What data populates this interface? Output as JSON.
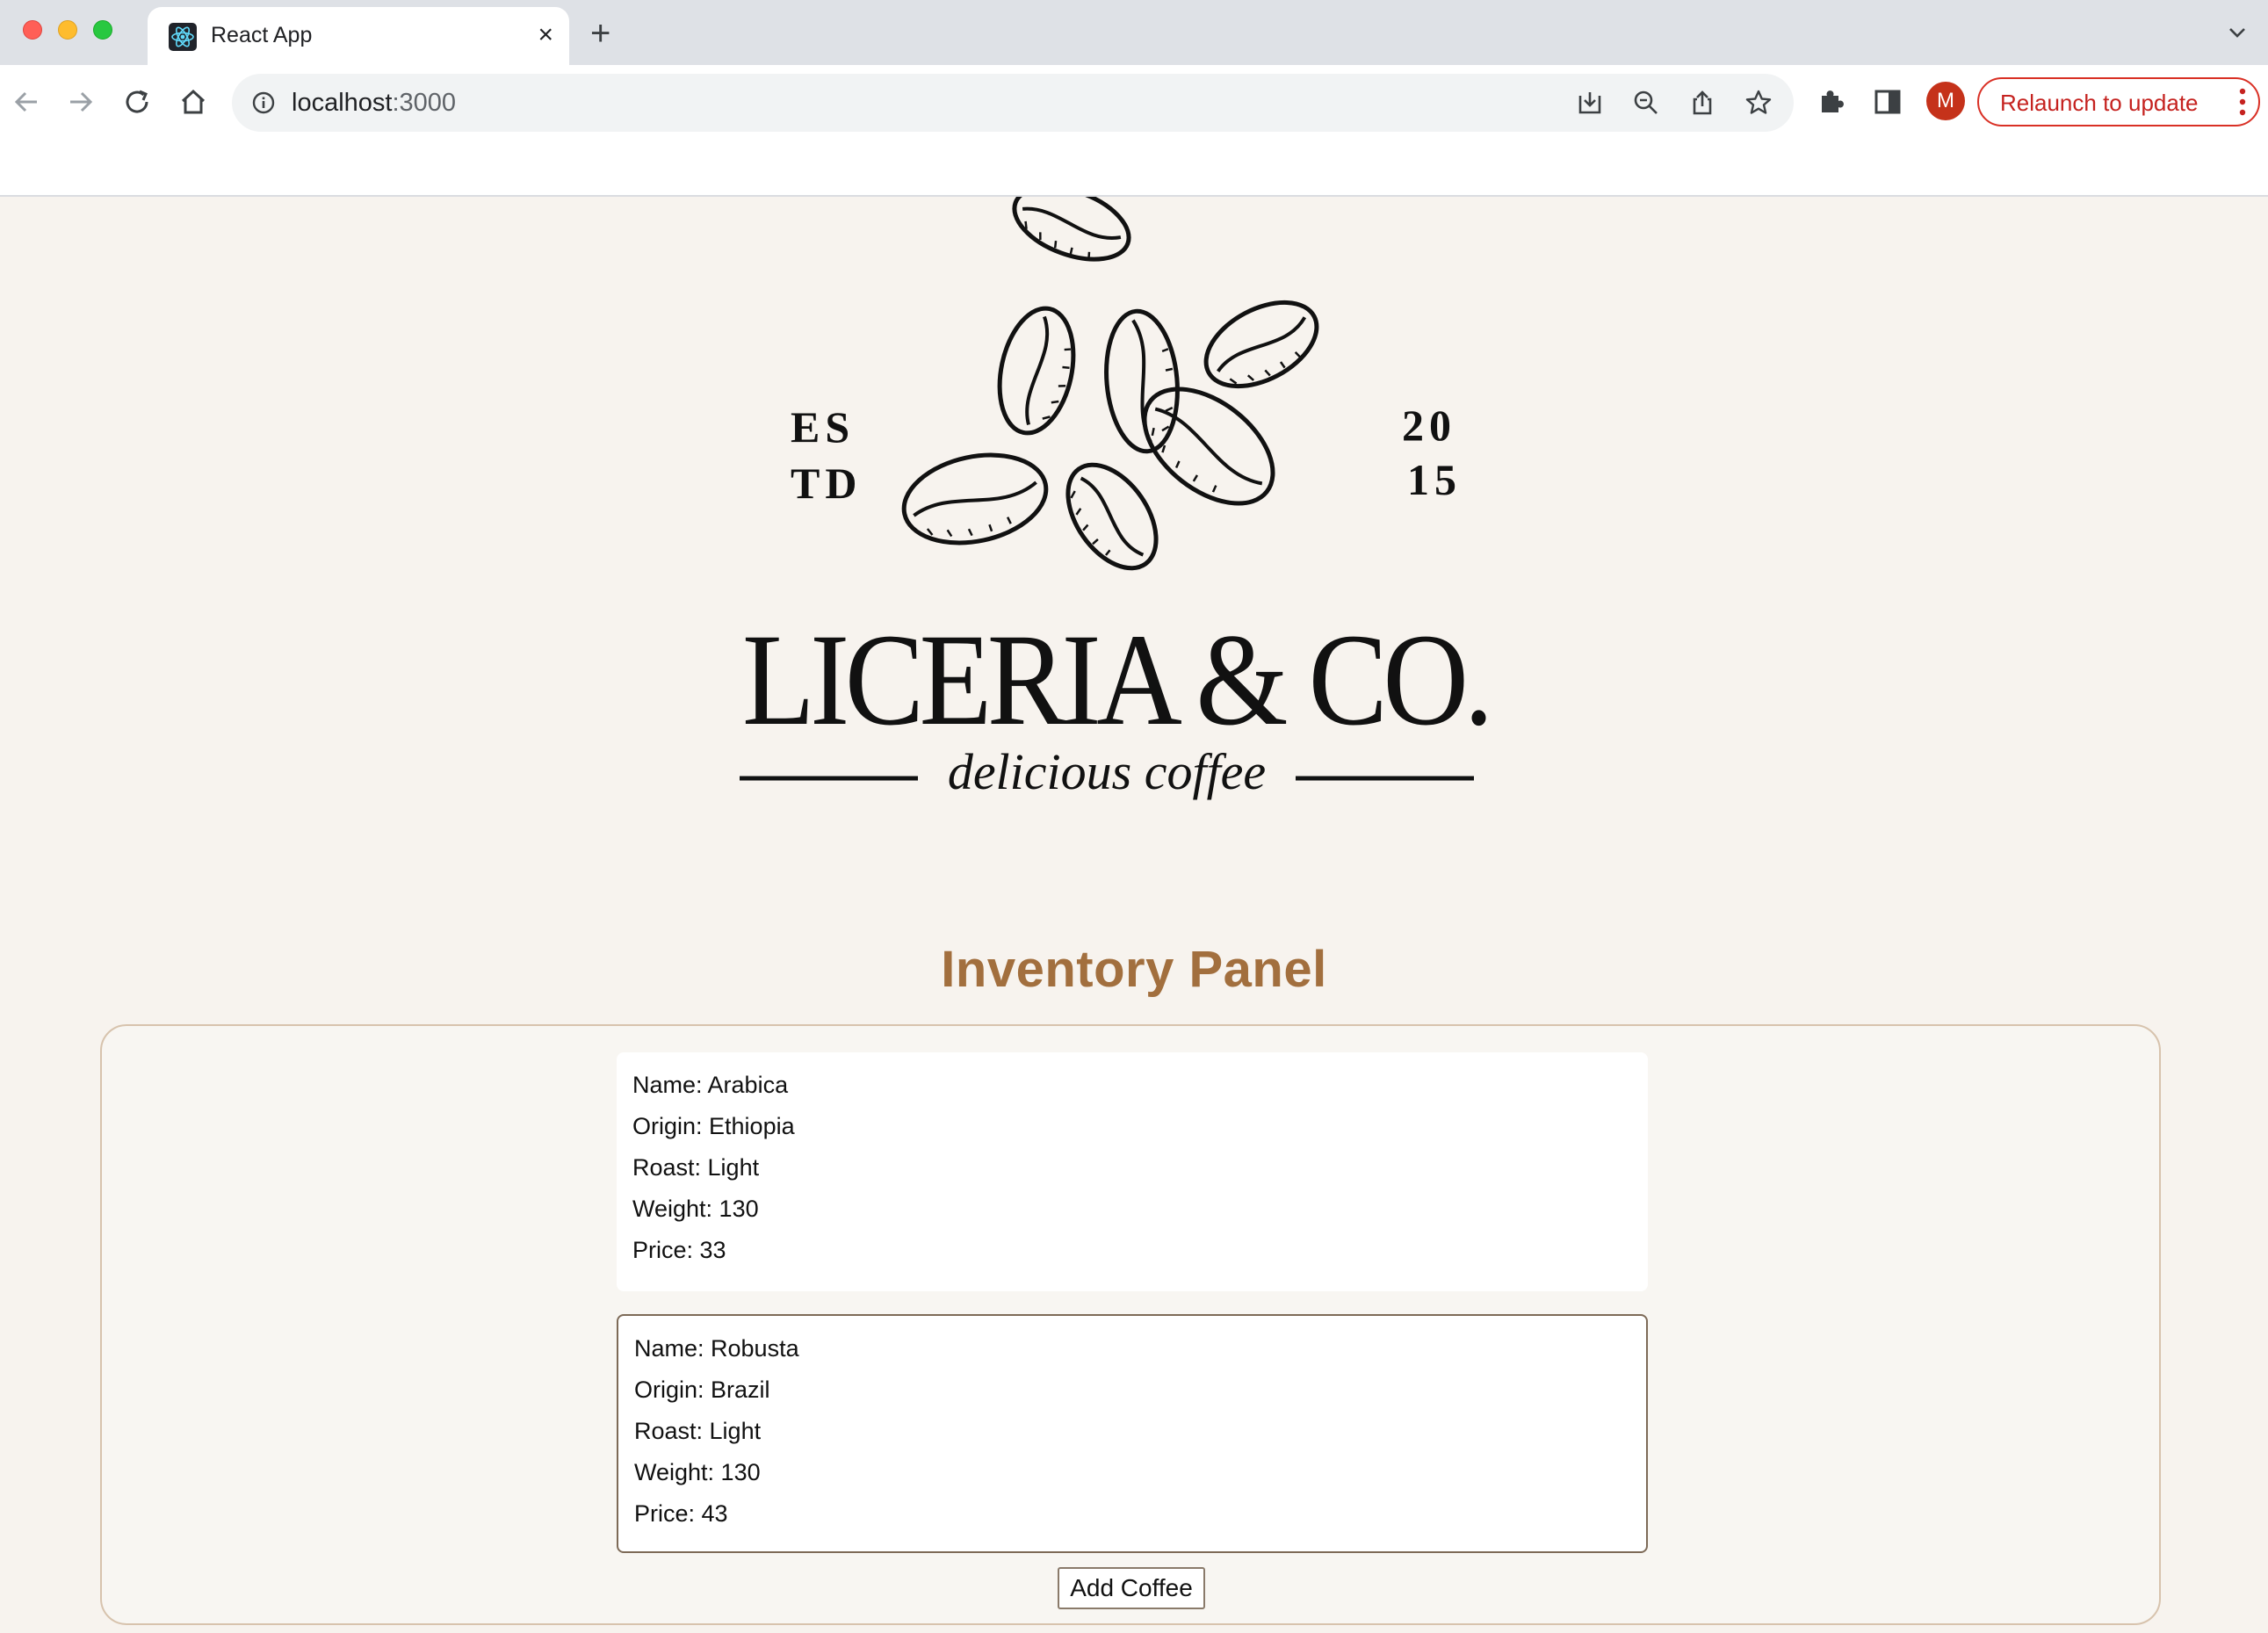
{
  "browser": {
    "tab_title": "React App",
    "tab_close": "×",
    "new_tab": "+",
    "url_host": "localhost",
    "url_port": ":3000",
    "profile_initial": "M",
    "relaunch_label": "Relaunch to update"
  },
  "logo": {
    "est_left_top": "ES",
    "est_left_bottom": "TD",
    "est_right_top": "20",
    "est_right_bottom": "15",
    "brand_name": "LICERIA & CO.",
    "tagline": "delicious coffee"
  },
  "page": {
    "heading": "Inventory Panel",
    "heading_color": "#a26f3e"
  },
  "inventory": {
    "items": [
      {
        "name": "Name: Arabica",
        "origin": "Origin: Ethiopia",
        "roast": "Roast: Light",
        "weight": "Weight: 130",
        "price": "Price: 33"
      },
      {
        "name": "Name: Robusta",
        "origin": "Origin: Brazil",
        "roast": "Roast: Light",
        "weight": "Weight: 130",
        "price": "Price: 43"
      }
    ],
    "add_button_label": "Add Coffee"
  }
}
